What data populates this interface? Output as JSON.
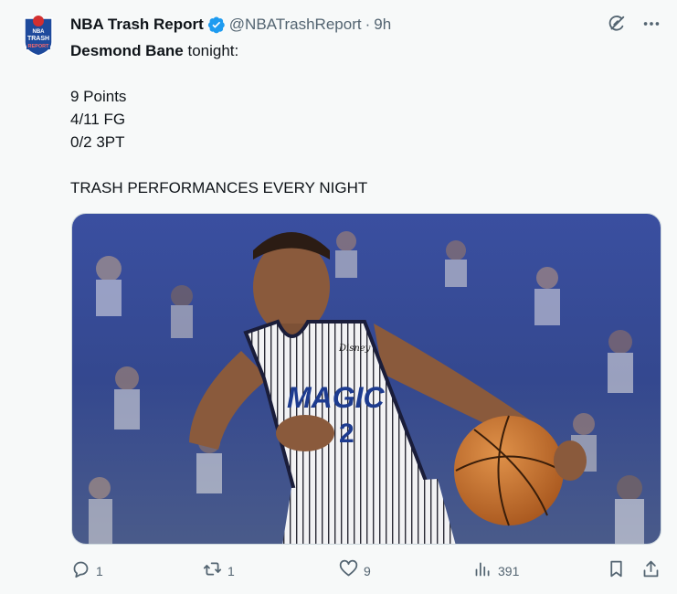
{
  "author": {
    "name": "NBA Trash Report",
    "handle": "@NBATrashReport",
    "separator": "·",
    "time": "9h",
    "avatar_text_top": "NBA",
    "avatar_text_mid": "TRASH",
    "avatar_text_bottom": "REPORT"
  },
  "tweet": {
    "player_name": "Desmond Bane",
    "intro_suffix": " tonight:",
    "stat_points": "9 Points",
    "stat_fg": "4/11 FG",
    "stat_3pt": "0/2 3PT",
    "closing": "TRASH PERFORMANCES EVERY NIGHT"
  },
  "media": {
    "jersey_brand": "Disney",
    "jersey_text": "MAGIC",
    "jersey_number": "2"
  },
  "actions": {
    "replies": "1",
    "reposts": "1",
    "likes": "9",
    "views": "391"
  },
  "colors": {
    "verified": "#1d9bf0",
    "muted": "#536471",
    "background": "#f7f9f9",
    "avatar_blue": "#1e4a9c",
    "avatar_red": "#d32f2f"
  },
  "icons": [
    "grok-icon",
    "more-icon",
    "reply-icon",
    "repost-icon",
    "like-icon",
    "views-icon",
    "bookmark-icon",
    "share-icon",
    "verified-badge-icon"
  ]
}
